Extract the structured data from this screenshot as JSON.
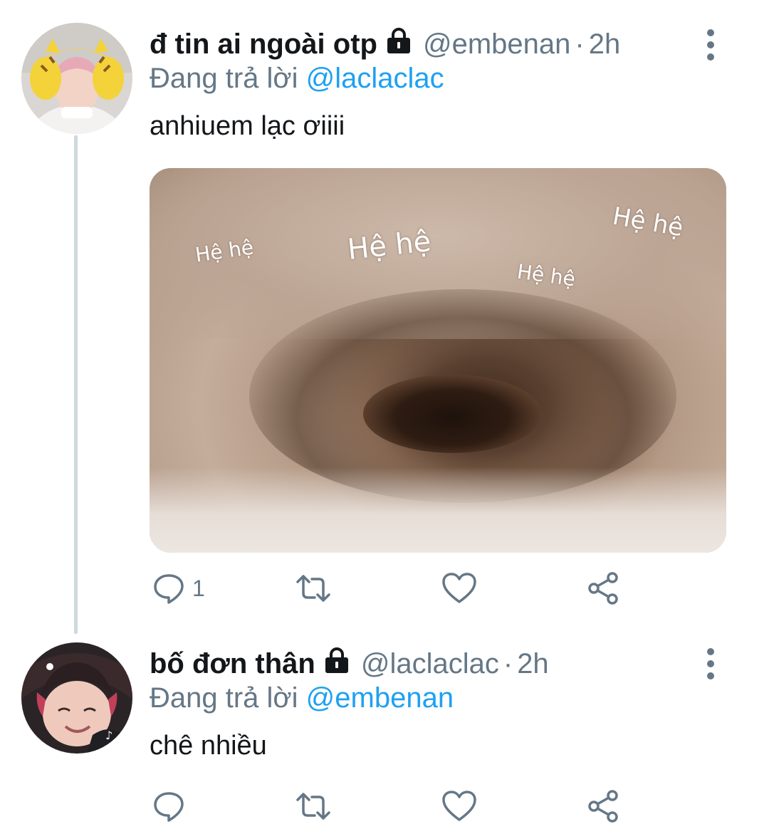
{
  "tweets": [
    {
      "display_name": "đ tin ai ngoài otp",
      "handle": "@embenan",
      "separator": "·",
      "time": "2h",
      "replying_prefix": "Đang trả lời",
      "replying_to": "@laclaclac",
      "text": "anhiuem lạc ơiiii",
      "media": {
        "captions": [
          "Hệ hệ",
          "Hệ hệ",
          "Hệ hệ",
          "Hệ hệ"
        ]
      },
      "reply_count": "1",
      "avatar_icon": "avatar-tiger-headband",
      "protected_icon": "lock-icon"
    },
    {
      "display_name": "bố đơn thân",
      "handle": "@laclaclac",
      "separator": "·",
      "time": "2h",
      "replying_prefix": "Đang trả lời",
      "replying_to": "@embenan",
      "text": "chê nhiều",
      "reply_count": "",
      "avatar_icon": "avatar-smiling-boy",
      "protected_icon": "lock-icon"
    }
  ],
  "icons": {
    "reply": "reply-icon",
    "retweet": "retweet-icon",
    "like": "heart-icon",
    "share": "share-icon",
    "more": "more-vertical-icon"
  },
  "colors": {
    "text": "#14171a",
    "secondary": "#657786",
    "mention": "#1da1f2",
    "thread_line": "#cfd9de"
  }
}
